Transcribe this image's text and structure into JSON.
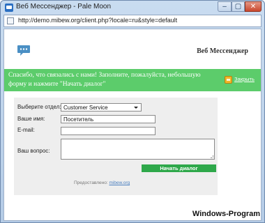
{
  "window": {
    "title": "Веб Мессенджер - Pale Moon",
    "controls": {
      "minimize": "–",
      "maximize": "▢",
      "close": "✕"
    }
  },
  "addressbar": {
    "url": "http://demo.mibew.org/client.php?locale=ru&style=default"
  },
  "header": {
    "title": "Веб Мессенджер",
    "logo_icon": "chat-bubble-icon"
  },
  "banner": {
    "text": "Спасибо, что связались с нами! Заполните, пожалуйста, небольшую форму и нажмите \"Начать диалог\"",
    "close_label": "Закрыть",
    "close_icon": "close-window-icon"
  },
  "form": {
    "department_label": "Выберите отдел:",
    "department_value": "Customer Service",
    "name_label": "Ваше имя:",
    "name_value": "Посетитель",
    "email_label": "E-mail:",
    "email_value": "",
    "question_label": "Ваш вопрос:",
    "question_value": "",
    "submit_label": "Начать диалог"
  },
  "footer": {
    "powered_label": "Предоставлено:",
    "powered_link": "mibew.org"
  },
  "watermark": "Windows-Program",
  "colors": {
    "banner": "#5ccc6b",
    "submit_button": "#2ea84a",
    "form_background": "#eeeeee",
    "logo": "#4a8fc4"
  }
}
